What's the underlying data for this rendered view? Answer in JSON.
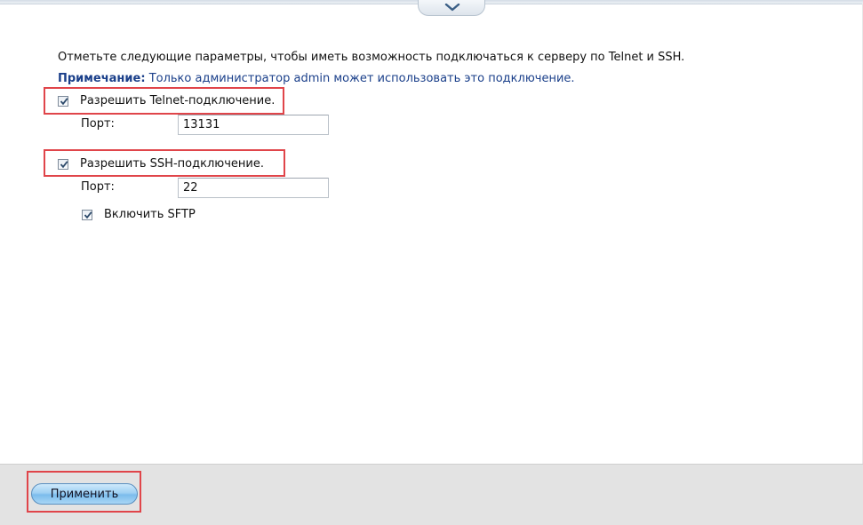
{
  "intro_text": "Отметьте следующие параметры, чтобы иметь возможность подключаться к серверу по Telnet и SSH.",
  "note": {
    "label": "Примечание:",
    "text": "Только администратор admin может использовать это подключение."
  },
  "telnet": {
    "checkbox_label": "Разрешить Telnet-подключение.",
    "checked": true,
    "port_label": "Порт:",
    "port_value": "13131"
  },
  "ssh": {
    "checkbox_label": "Разрешить SSH-подключение.",
    "checked": true,
    "port_label": "Порт:",
    "port_value": "22"
  },
  "sftp": {
    "checkbox_label": "Включить SFTP",
    "checked": true
  },
  "footer": {
    "apply_label": "Применить"
  },
  "icons": {
    "collapse": "chevron-down-icon",
    "check": "checkmark-icon"
  },
  "colors": {
    "note_text": "#1a3f8a",
    "highlight_border": "#e0454a",
    "apply_button": "#9fd0f3"
  }
}
